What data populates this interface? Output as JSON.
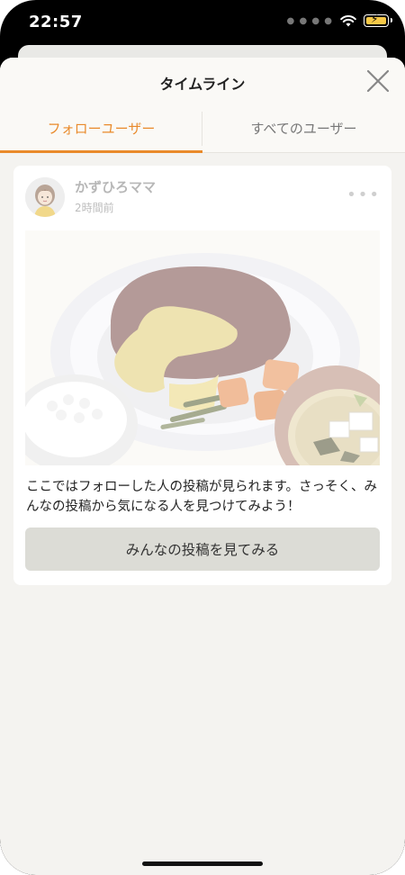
{
  "status_bar": {
    "time": "22:57",
    "icons": [
      "signal-dots-icon",
      "wifi-icon",
      "battery-charging-icon"
    ]
  },
  "sheet": {
    "title": "タイムライン",
    "close_icon": "close-icon"
  },
  "tabs": [
    {
      "label": "フォローユーザー",
      "active": true
    },
    {
      "label": "すべてのユーザー",
      "active": false
    }
  ],
  "post": {
    "user_name": "かずひろママ",
    "time_ago": "2時間前",
    "more_icon": "more-horizontal-icon",
    "image": "hamburg-steak-meal-illustration",
    "message": "ここではフォローした人の投稿が見られます。さっそく、みんなの投稿から気になる人を見つけてみよう！",
    "cta_label": "みんなの投稿を見てみる"
  },
  "colors": {
    "accent": "#e98a2b",
    "sheet_bg": "#f4f3f0",
    "button_bg": "#dcdcd6"
  }
}
